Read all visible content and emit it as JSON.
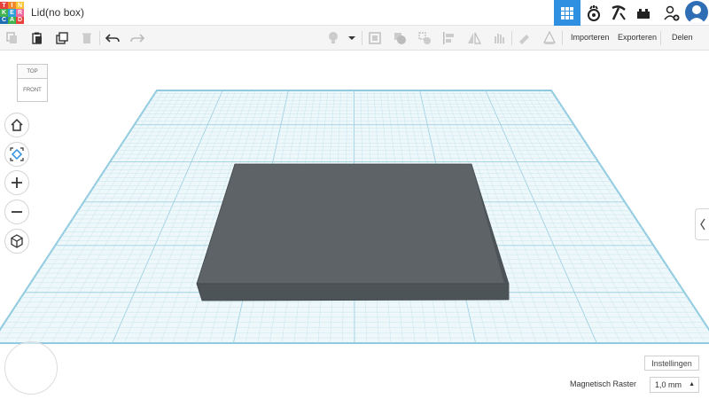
{
  "header": {
    "logo_letters": [
      "T",
      "I",
      "N",
      "K",
      "E",
      "R",
      "C",
      "A",
      "D"
    ],
    "logo_colors": [
      "#e8423d",
      "#f0892b",
      "#f9c42e",
      "#3fb34f",
      "#2a9ed8",
      "#f06a9d",
      "#1f6fb3",
      "#3fb34f",
      "#e8423d"
    ],
    "title": "Lid(no box)",
    "accent": "#2f8fe0"
  },
  "toolbar": {
    "import_label": "Importeren",
    "export_label": "Exporteren",
    "share_label": "Delen"
  },
  "viewcube": {
    "top_label": "TOP",
    "front_label": "FRONT"
  },
  "footer": {
    "settings_label": "Instellingen",
    "snap_label": "Magnetisch Raster",
    "snap_value": "1,0 mm"
  },
  "colors": {
    "grid_line": "#c8e4ee",
    "grid_major": "#9fd0e2",
    "shape_top": "#5d6366",
    "shape_side": "#4d5457"
  }
}
